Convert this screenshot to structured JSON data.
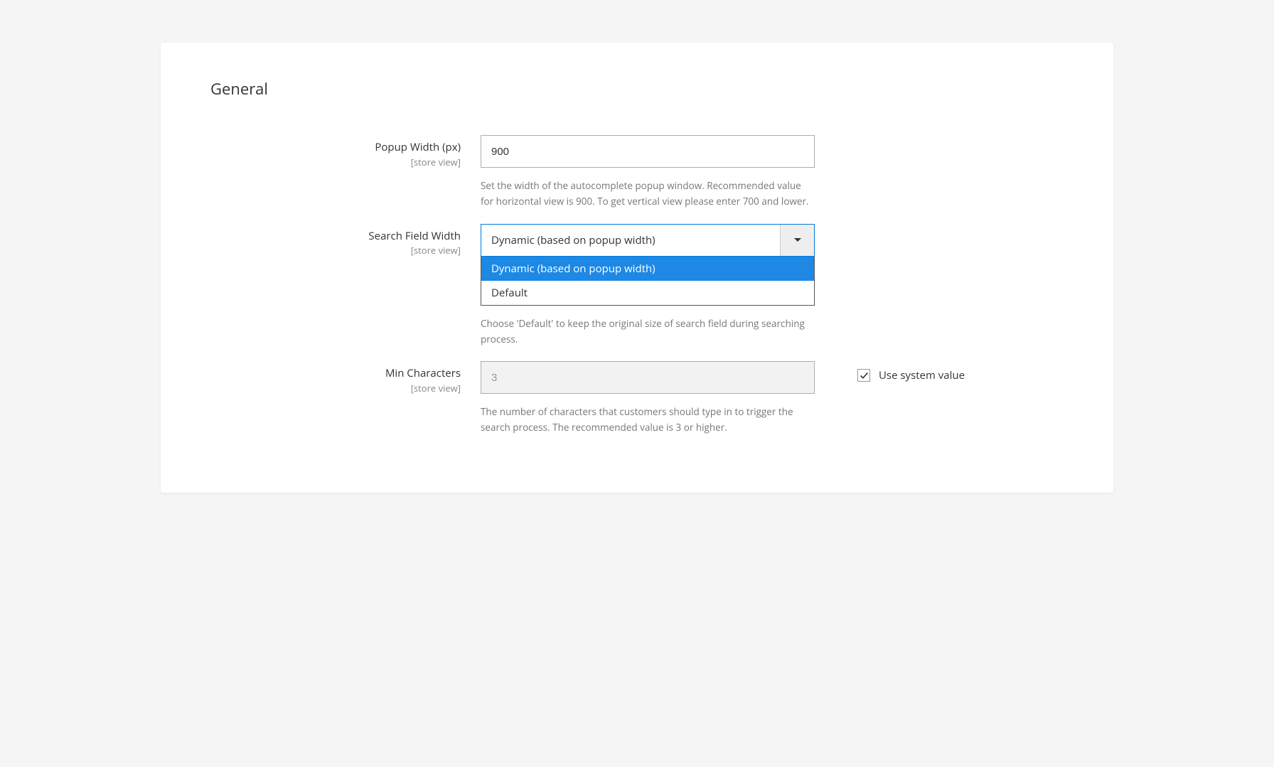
{
  "section": {
    "title": "General"
  },
  "fields": {
    "popup_width": {
      "label": "Popup Width (px)",
      "scope": "[store view]",
      "value": "900",
      "help": "Set the width of the autocomplete popup window. Recommended value for horizontal view is 900. To get vertical view please enter 700 and lower."
    },
    "search_field_width": {
      "label": "Search Field Width",
      "scope": "[store view]",
      "selected": "Dynamic (based on popup width)",
      "options": {
        "0": "Dynamic (based on popup width)",
        "1": "Default"
      },
      "help": "Choose 'Default' to keep the original size of search field during searching process."
    },
    "min_characters": {
      "label": "Min Characters",
      "scope": "[store view]",
      "value": "3",
      "help": "The number of characters that customers should type in to trigger the search process. The recommended value is 3 or higher.",
      "use_system_label": "Use system value"
    }
  }
}
